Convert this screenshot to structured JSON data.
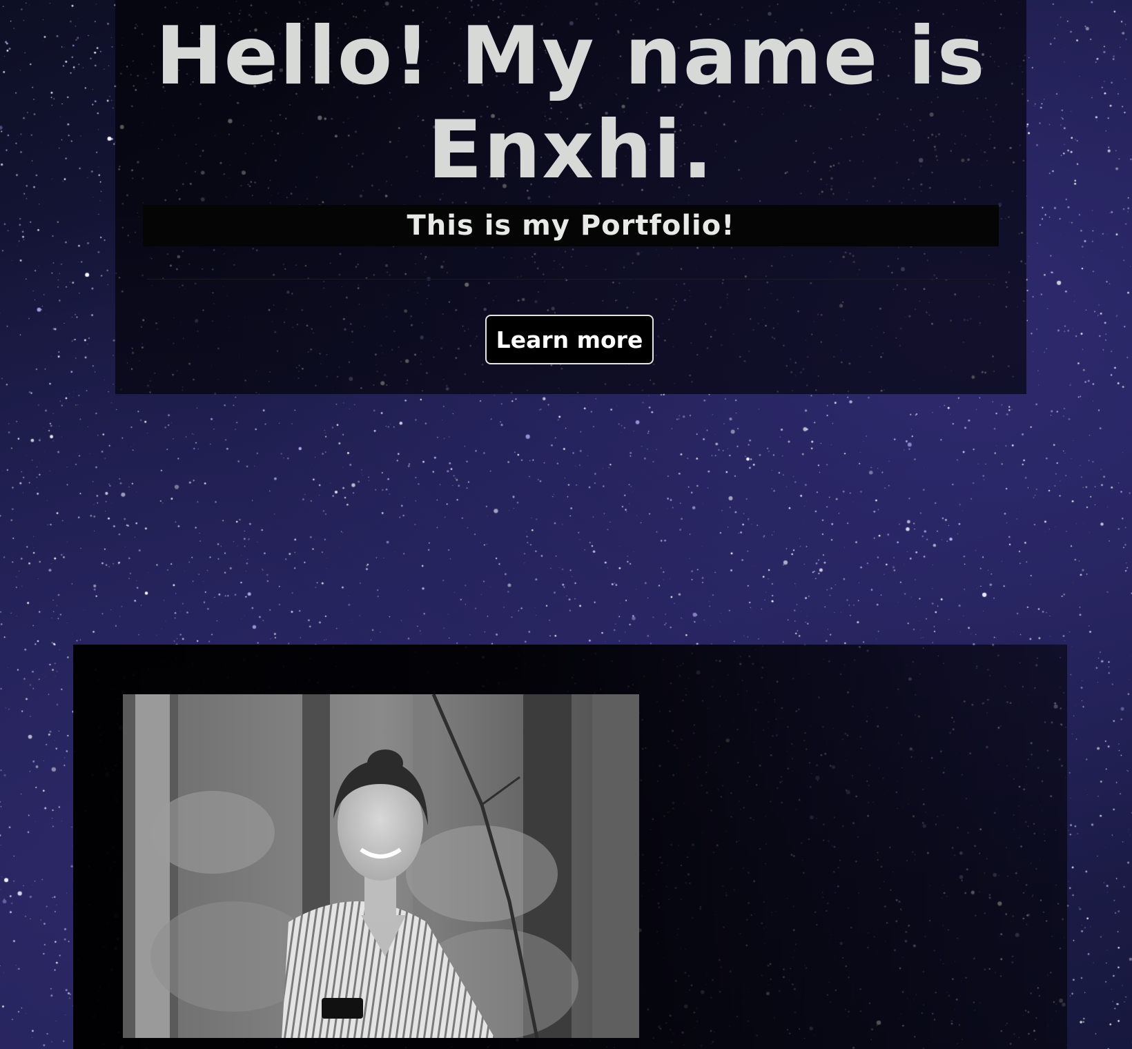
{
  "hero": {
    "title": "Hello! My name is Enxhi.",
    "subtitle": "This is my Portfolio!",
    "cta_label": "Learn more"
  },
  "about": {
    "photo_icon": "portrait-photo-grayscale"
  },
  "colors": {
    "title_text": "#d6d9d6",
    "background_sky": "#1a1a45",
    "panel": "#000000",
    "button_border": "#e6e6e6"
  }
}
